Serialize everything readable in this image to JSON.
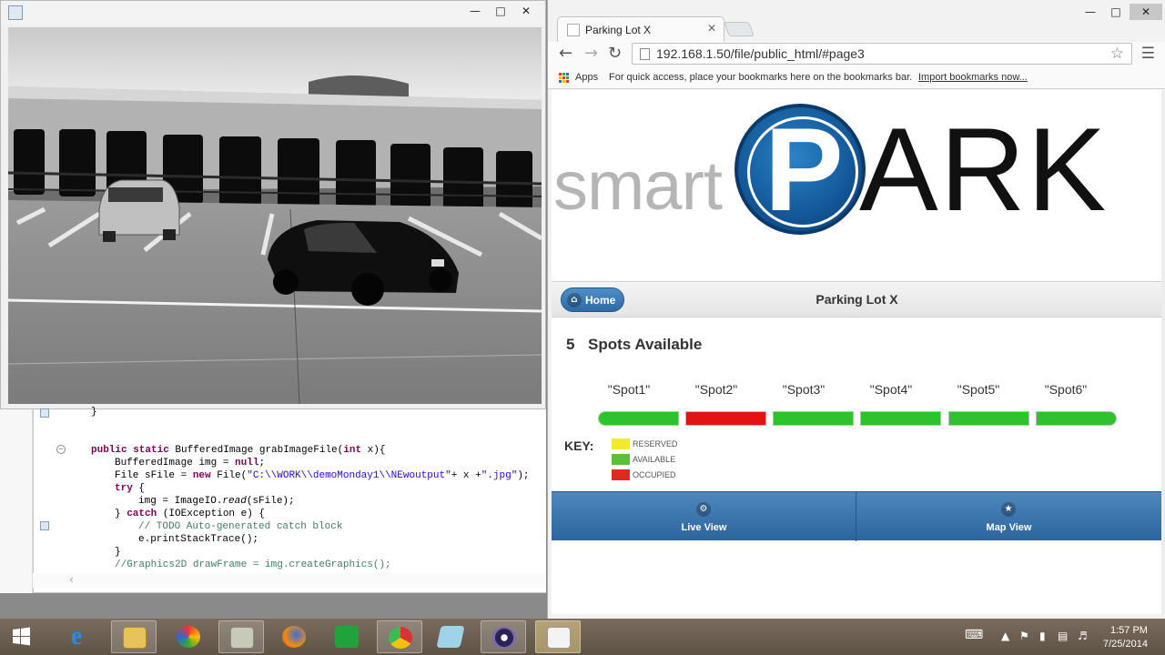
{
  "browser": {
    "tab_title": "Parking Lot X",
    "url": "192.168.1.50/file/public_html/#page3",
    "bookmarks_bar": {
      "apps_label": "Apps",
      "hint": "For quick access, place your bookmarks here on the bookmarks bar.",
      "import_link": "Import bookmarks now..."
    }
  },
  "page": {
    "logo": {
      "smart": "smart",
      "p": "P",
      "ark": "ARK"
    },
    "home_button": "Home",
    "header_title": "Parking Lot X",
    "spots_count": "5",
    "spots_label": "Spots Available",
    "spots": [
      {
        "label": "\"Spot1\"",
        "status": "available"
      },
      {
        "label": "\"Spot2\"",
        "status": "occupied"
      },
      {
        "label": "\"Spot3\"",
        "status": "available"
      },
      {
        "label": "\"Spot4\"",
        "status": "available"
      },
      {
        "label": "\"Spot5\"",
        "status": "available"
      },
      {
        "label": "\"Spot6\"",
        "status": "available"
      }
    ],
    "key": {
      "label": "KEY:",
      "items": [
        {
          "label": "RESERVED",
          "color": "#f3ea2a"
        },
        {
          "label": "AVAILABLE",
          "color": "#5cbf3a"
        },
        {
          "label": "OCCUPIED",
          "color": "#dd2b1f"
        }
      ]
    },
    "footer": {
      "live_view": "Live View",
      "map_view": "Map View"
    }
  },
  "status_colors": {
    "available": "#2fc22f",
    "occupied": "#e51212",
    "reserved": "#f3ea2a"
  },
  "code": {
    "lines": [
      "}",
      "public static BufferedImage grabImageFile(int x){",
      "BufferedImage img = null;",
      "File sFile = new File(\"C:\\\\WORK\\\\demoMonday1\\\\NEwoutput\"+ x +\".jpg\");",
      "try {",
      "img = ImageIO.read(sFile);",
      "} catch (IOException e) {",
      "// TODO Auto-generated catch block",
      "e.printStackTrace();",
      "}",
      "//Graphics2D drawFrame = img.createGraphics();"
    ]
  },
  "taskbar": {
    "time": "1:57 PM",
    "date": "7/25/2014"
  }
}
